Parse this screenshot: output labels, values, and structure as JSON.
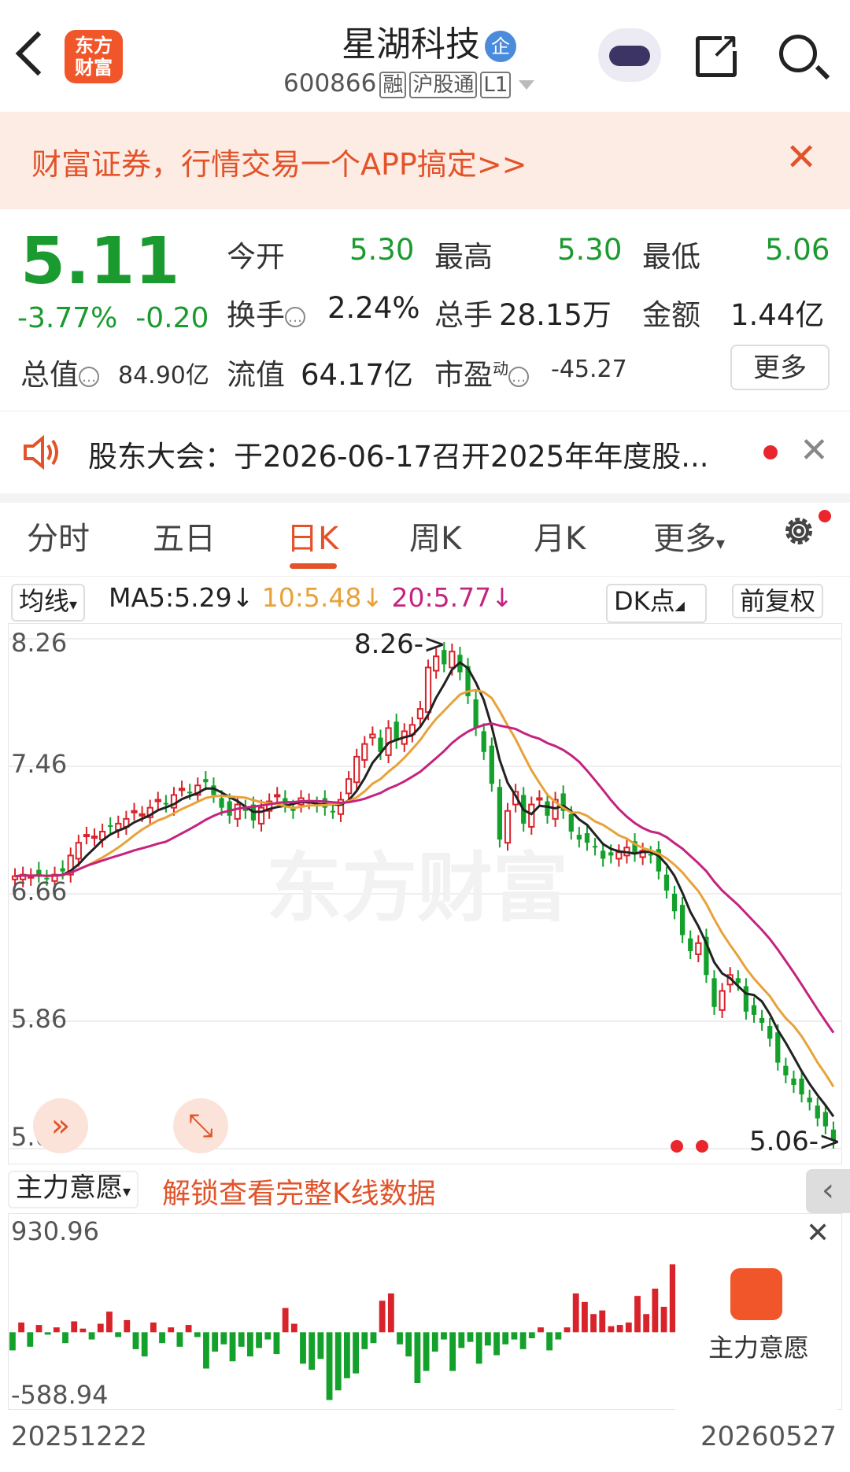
{
  "header": {
    "logo_line1": "东方",
    "logo_line2": "财富",
    "stock_name": "星湖科技",
    "badge": "企",
    "code": "600866",
    "tags": [
      "融",
      "沪股通",
      "L1"
    ]
  },
  "banner": {
    "text": "财富证券，行情交易一个APP搞定>>"
  },
  "quote": {
    "price": "5.11",
    "change_pct": "-3.77%",
    "change": "-0.20",
    "open_label": "今开",
    "open": "5.30",
    "high_label": "最高",
    "high": "5.30",
    "low_label": "最低",
    "low": "5.06",
    "turnover_label": "换手",
    "turnover": "2.24%",
    "volume_label": "总手",
    "volume": "28.15万",
    "amount_label": "金额",
    "amount": "1.44亿",
    "mktcap_label": "总值",
    "mktcap": "84.90亿",
    "float_label": "流值",
    "float": "64.17亿",
    "pe_label": "市盈",
    "pe_sup": "动",
    "pe": "-45.27",
    "more_label": "更多"
  },
  "notice": {
    "text": "股东大会：于2026-06-17召开2025年年度股..."
  },
  "tabs": [
    {
      "label": "分时"
    },
    {
      "label": "五日"
    },
    {
      "label": "日K"
    },
    {
      "label": "周K"
    },
    {
      "label": "月K"
    },
    {
      "label": "更多"
    }
  ],
  "ma_row": {
    "avg_label": "均线",
    "ma5": "MA5:5.29↓",
    "ma10": "10:5.48↓",
    "ma20": "20:5.77↓",
    "dk_label": "DK点",
    "adj_label": "前复权"
  },
  "colors": {
    "up": "#d8232a",
    "down": "#13a12b",
    "ma5": "#222222",
    "ma10": "#e8a23a",
    "ma20": "#c4237f",
    "accent": "#e2532a"
  },
  "chart_data": [
    {
      "type": "candlestick",
      "y_ticks": [
        "8.26",
        "7.46",
        "6.66",
        "5.86",
        "5.06"
      ],
      "ylim": [
        5.06,
        8.26
      ],
      "max_annotation": "8.26->",
      "min_annotation": "5.06->",
      "watermark": "东方财富",
      "series": [
        {
          "name": "MA5"
        },
        {
          "name": "10"
        },
        {
          "name": "20"
        }
      ],
      "close": [
        6.77,
        6.78,
        6.77,
        6.78,
        6.76,
        6.78,
        6.8,
        6.9,
        6.98,
        7.03,
        7.02,
        7.05,
        7.08,
        7.1,
        7.13,
        7.18,
        7.16,
        7.2,
        7.25,
        7.22,
        7.28,
        7.32,
        7.3,
        7.34,
        7.36,
        7.28,
        7.2,
        7.15,
        7.22,
        7.18,
        7.12,
        7.2,
        7.24,
        7.28,
        7.22,
        7.18,
        7.26,
        7.24,
        7.22,
        7.2,
        7.18,
        7.25,
        7.38,
        7.52,
        7.6,
        7.66,
        7.55,
        7.7,
        7.62,
        7.68,
        7.72,
        7.82,
        8.08,
        8.15,
        8.1,
        8.18,
        8.05,
        7.9,
        7.7,
        7.55,
        7.35,
        7.0,
        7.18,
        7.3,
        7.1,
        7.22,
        7.26,
        7.15,
        7.25,
        7.18,
        7.05,
        7.0,
        6.98,
        6.95,
        6.88,
        6.9,
        6.92,
        6.95,
        6.91,
        6.93,
        6.9,
        6.8,
        6.68,
        6.55,
        6.4,
        6.3,
        6.35,
        6.15,
        5.95,
        6.05,
        6.15,
        6.1,
        5.92,
        5.9,
        5.85,
        5.75,
        5.6,
        5.52,
        5.46,
        5.4,
        5.35,
        5.25,
        5.2,
        5.11
      ]
    },
    {
      "type": "bar",
      "name": "主力意愿",
      "ylim": [
        -588.94,
        930.96
      ],
      "y_ticks": [
        "930.96",
        "-588.94"
      ],
      "x_range": [
        "20251222",
        "20260527"
      ],
      "values": [
        -150,
        80,
        -120,
        60,
        -20,
        40,
        -90,
        90,
        30,
        -60,
        70,
        170,
        -40,
        100,
        -140,
        -200,
        80,
        -90,
        40,
        -120,
        60,
        -40,
        -300,
        -160,
        -100,
        -240,
        -120,
        -200,
        -130,
        -60,
        -180,
        200,
        70,
        -260,
        -310,
        -220,
        -560,
        -480,
        -380,
        -340,
        -140,
        -90,
        260,
        320,
        -100,
        -200,
        -420,
        -320,
        -160,
        -60,
        -320,
        -130,
        -80,
        -260,
        -110,
        -190,
        -100,
        -60,
        -140,
        -50,
        40,
        -150,
        -60,
        40,
        320,
        250,
        150,
        180,
        50,
        60,
        80,
        300,
        150,
        360,
        210,
        560
      ]
    }
  ],
  "lower": {
    "dropdown_label": "主力意愿",
    "unlock_text": "解锁查看完整K线数据",
    "overlay_label": "主力意愿"
  }
}
